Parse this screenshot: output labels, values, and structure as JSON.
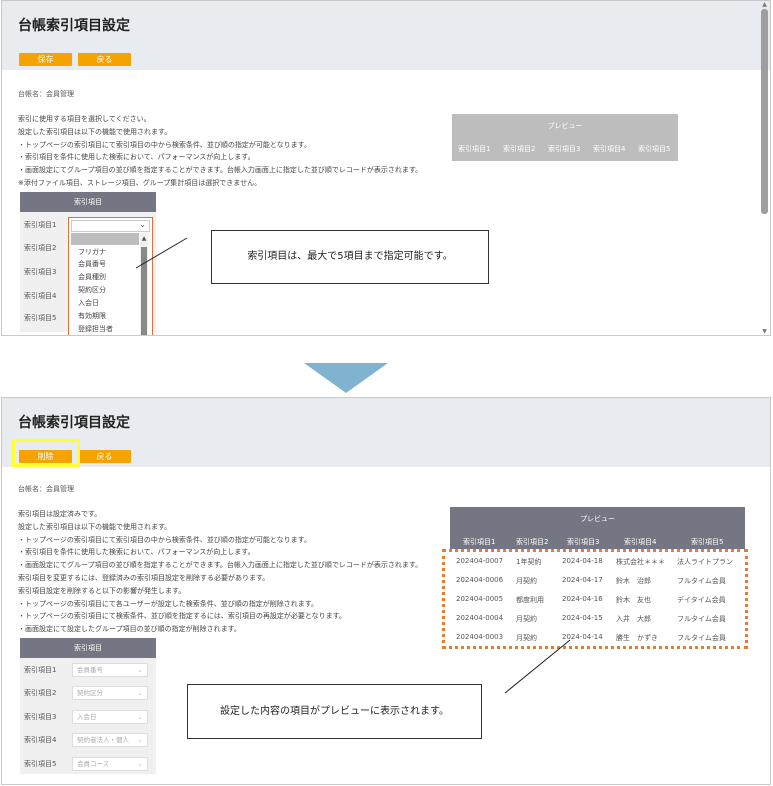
{
  "top": {
    "title": "台帳索引項目設定",
    "save_label": "保存",
    "back_label": "戻る",
    "ledger": "台帳名：会員管理",
    "desc": [
      "索引に使用する項目を選択してください。",
      "設定した索引項目は以下の機能で使用されます。",
      "・トップページの索引項目にて索引項目の中から検索条件、並び順の指定が可能となります。",
      "・索引項目を条件に使用した検索において、パフォーマンスが向上します。",
      "・画面設定にてグループ項目の並び順を指定することができます。台帳入力画面上に指定した並び順でレコードが表示されます。",
      "※添付ファイル項目、ストレージ項目、グループ集計項目は選択できません。"
    ],
    "index_header": "索引項目",
    "rows": [
      "索引項目1",
      "索引項目2",
      "索引項目3",
      "索引項目4",
      "索引項目5"
    ],
    "dropdown_options": [
      "フリガナ",
      "会員番号",
      "会員種別",
      "契約区分",
      "入会日",
      "有効期限",
      "登録担当者"
    ],
    "preview_title": "プレビュー",
    "preview_cols": [
      "索引項目1",
      "索引項目2",
      "索引項目3",
      "索引項目4",
      "索引項目5"
    ],
    "callout": "索引項目は、最大で5項目まで指定可能です。"
  },
  "bottom": {
    "title": "台帳索引項目設定",
    "delete_label": "削除",
    "back_label": "戻る",
    "ledger": "台帳名：会員管理",
    "desc": [
      "索引項目は設定済みです。",
      "設定した索引項目は以下の機能で使用されます。",
      "・トップページの索引項目にて索引項目の中から検索条件、並び順の指定が可能となります。",
      "・索引項目を条件に使用した検索において、パフォーマンスが向上します。",
      "・画面設定にてグループ項目の並び順を指定することができます。台帳入力画面上に指定した並び順でレコードが表示されます。",
      "索引項目を変更するには、登録済みの索引項目設定を削除する必要があります。",
      "索引項目設定を削除すると以下の影響が発生します。",
      "・トップページの索引項目にて各ユーザーが設定した検索条件、並び順の指定が削除されます。",
      "・トップページの索引項目にて検索条件、並び順を指定するには、索引項目の再設定が必要となります。",
      "・画面設定にて設定したグループ項目の並び順の指定が削除されます。"
    ],
    "index_header": "索引項目",
    "rows": [
      {
        "label": "索引項目1",
        "value": "会員番号"
      },
      {
        "label": "索引項目2",
        "value": "契約区分"
      },
      {
        "label": "索引項目3",
        "value": "入会日"
      },
      {
        "label": "索引項目4",
        "value": "契約者法人・個人"
      },
      {
        "label": "索引項目5",
        "value": "会員コース"
      }
    ],
    "preview_title": "プレビュー",
    "preview_cols": [
      "索引項目1",
      "索引項目2",
      "索引項目3",
      "索引項目4",
      "索引項目5"
    ],
    "preview_rows": [
      [
        "202404-0007",
        "1年契約",
        "2024-04-18",
        "株式会社＊＊＊",
        "法人ライトプラン"
      ],
      [
        "202404-0006",
        "月契約",
        "2024-04-17",
        "鈴木　治郎",
        "フルタイム会員"
      ],
      [
        "202404-0005",
        "都度利用",
        "2024-04-16",
        "鈴木　友也",
        "デイタイム会員"
      ],
      [
        "202404-0004",
        "月契約",
        "2024-04-15",
        "入井　大郎",
        "フルタイム会員"
      ],
      [
        "202404-0003",
        "月契約",
        "2024-04-14",
        "勝生　かずき",
        "フルタイム会員"
      ]
    ],
    "callout": "設定した内容の項目がプレビューに表示されます。"
  },
  "colors": {
    "accent": "#f5a300",
    "header_gray": "#757683",
    "highlight": "#ffff33",
    "dotted_frame": "#e97c2c",
    "arrow": "#7fb3cf"
  }
}
